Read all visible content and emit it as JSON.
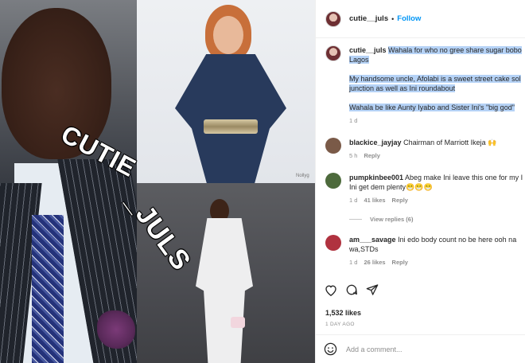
{
  "post_image": {
    "watermark_1": "CUTIE",
    "watermark_2": "_JULS",
    "photo_tag": "Nollyg"
  },
  "header": {
    "username": "cutie__juls",
    "separator": "•",
    "follow_label": "Follow"
  },
  "caption": {
    "username": "cutie__juls",
    "line1": "Wahala for who no gree share sugar bobo",
    "line2": "Lagos",
    "line3": "My handsome uncle, Afolabi is a sweet street cake sol",
    "line4": "junction as well as Ini roundabout",
    "line5": "Wahala be like Aunty Iyabo and Sister Ini's \"big god\"",
    "time": "1 d"
  },
  "comments": [
    {
      "username": "blackice_jayjay",
      "text": "Chairman of Marriott Ikeja 🙌",
      "time": "5 h",
      "likes": "",
      "reply": "Reply",
      "avatar_color": "#7a5a48"
    },
    {
      "username": "pumpkinbee001",
      "text": "Abeg make Ini leave this one for my I",
      "text2": "Ini get dem plenty😁😁😁",
      "time": "1 d",
      "likes": "41 likes",
      "reply": "Reply",
      "avatar_color": "#4d6a3c"
    },
    {
      "username": "am___savage",
      "text": "Ini edo body count no be here ooh na",
      "text2": "wa,STDs",
      "time": "1 d",
      "likes": "26 likes",
      "reply": "Reply",
      "avatar_color": "#b0323f"
    }
  ],
  "view_replies": "View replies (6)",
  "likes_count": "1,532 likes",
  "posted_ago": "1 DAY AGO",
  "add_comment_placeholder": "Add a comment..."
}
